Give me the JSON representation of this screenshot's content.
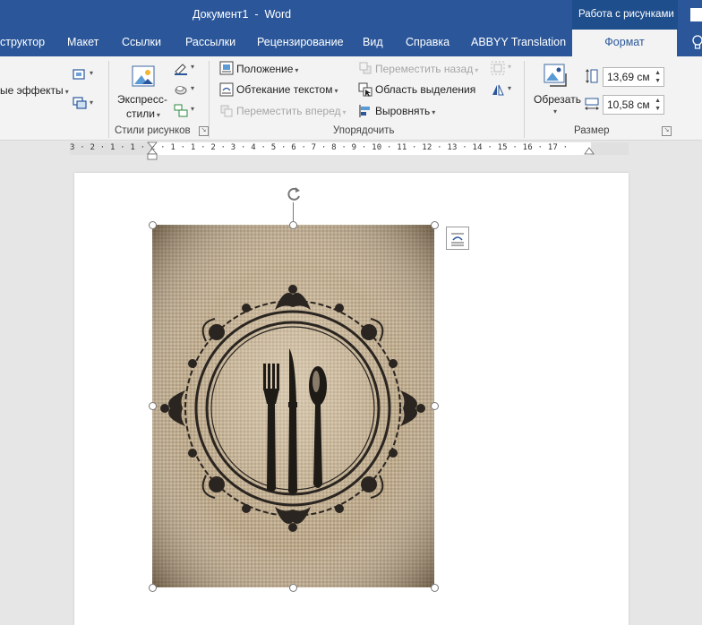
{
  "window": {
    "title": "Документ1  -  Word",
    "context_tab_group": "Работа с рисунками"
  },
  "tabs": [
    {
      "label": "structor",
      "full": "Конструктор"
    },
    {
      "label": "Макет"
    },
    {
      "label": "Ссылки"
    },
    {
      "label": "Рассылки"
    },
    {
      "label": "Рецензирование"
    },
    {
      "label": "Вид"
    },
    {
      "label": "Справка"
    },
    {
      "label": "ABBYY Translation"
    },
    {
      "label": "Формат",
      "active": true
    }
  ],
  "tab_labels": {
    "constructor": "структор",
    "layout": "Макет",
    "references": "Ссылки",
    "mailings": "Рассылки",
    "review": "Рецензирование",
    "view": "Вид",
    "help": "Справка",
    "abbyy": "ABBYY Translation",
    "format": "Формат"
  },
  "ribbon": {
    "effects_label": "ые эффекты",
    "express_styles": {
      "line1": "Экспресс-",
      "line2": "стили"
    },
    "group_picture_styles": "Стили рисунков",
    "position": "Положение",
    "wrap_text": "Обтекание текстом",
    "bring_forward": "Переместить вперед",
    "send_backward": "Переместить назад",
    "selection_pane": "Область выделения",
    "align": "Выровнять",
    "group_arrange": "Упорядочить",
    "crop": "Обрезать",
    "height": "13,69 см",
    "width": "10,58 см",
    "group_size": "Размер"
  },
  "ruler": {
    "marks": "3 · 2 · 1 · 1 · 2 · 1 · 1 · 2 · 3 · 4 · 5 · 6 · 7 · 8 · 9 · 10 · 11 · 12 · 13 · 14 · 15 · 16 · 17 ·"
  },
  "colors": {
    "title_bar": "#2b579a",
    "context_band": "#1f4e8c",
    "ribbon_bg": "#f3f3f3",
    "active_tab_text": "#2b579a",
    "burlap": "#b29d82"
  },
  "icons": [
    "lightbulb-icon",
    "picture-effects-icon",
    "express-styles-icon",
    "position-icon",
    "wrap-text-icon",
    "bring-forward-icon",
    "send-backward-icon",
    "selection-pane-icon",
    "align-icon",
    "group-icon",
    "rotate-icon",
    "crop-icon",
    "height-icon",
    "width-icon",
    "rotate-handle-icon",
    "layout-options-icon"
  ]
}
